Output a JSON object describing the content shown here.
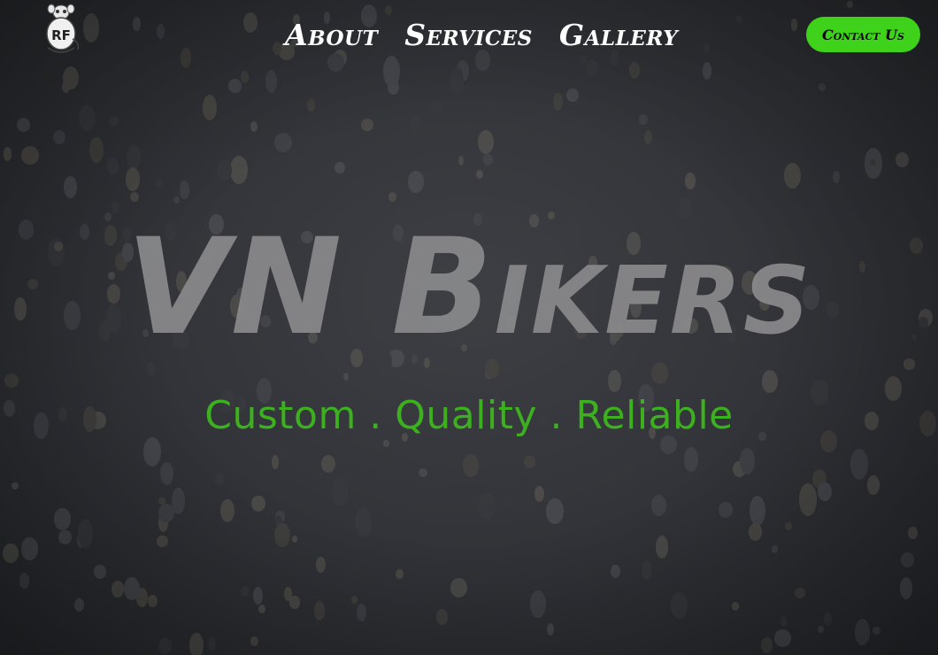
{
  "header": {
    "logo_name": "rat-fink-logo",
    "logo_text": "RF",
    "nav": [
      {
        "label": "About"
      },
      {
        "label": "Services"
      },
      {
        "label": "Gallery"
      }
    ],
    "contact_label": "Contact Us"
  },
  "hero": {
    "title": "VN Bikers",
    "tagline": "Custom . Quality . Reliable"
  },
  "colors": {
    "accent_green": "#3fd21a",
    "tagline_green": "#3cb01e",
    "title_gray": "#8a8a8c",
    "nav_text": "#ffffff"
  }
}
